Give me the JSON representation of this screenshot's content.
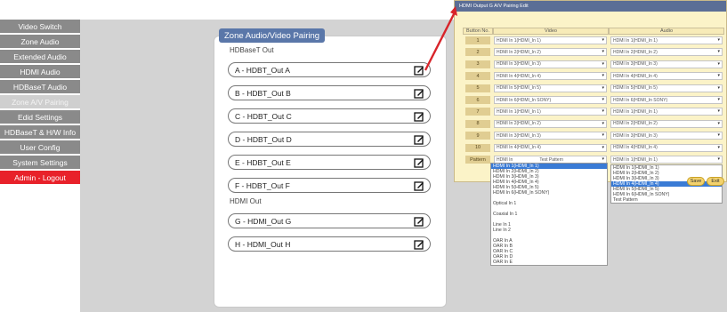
{
  "sidebar": {
    "items": [
      {
        "label": "Video Switch"
      },
      {
        "label": "Zone Audio"
      },
      {
        "label": "Extended Audio"
      },
      {
        "label": "HDMI Audio"
      },
      {
        "label": "HDBaseT Audio"
      },
      {
        "label": "Zone A/V Pairing",
        "active": true
      },
      {
        "label": "Edid Settings"
      },
      {
        "label": "HDBaseT & H/W Info"
      },
      {
        "label": "User Config"
      },
      {
        "label": "System Settings"
      },
      {
        "label": "Admin - Logout"
      }
    ]
  },
  "panel": {
    "title": "Zone Audio/Video Pairing",
    "groups": [
      {
        "label": "HDBaseT Out",
        "zones": [
          "A - HDBT_Out A",
          "B - HDBT_Out B",
          "C - HDBT_Out C",
          "D - HDBT_Out D",
          "E - HDBT_Out E",
          "F - HDBT_Out F"
        ]
      },
      {
        "label": "HDMI Out",
        "zones": [
          "G - HDMI_Out G",
          "H - HDMI_Out H"
        ]
      }
    ],
    "edit_icon": "edit-icon"
  },
  "dialog": {
    "title": "HDMI Output G A/V Pairing Edit",
    "headers": {
      "button_no": "Button No.",
      "video": "Video",
      "audio": "Audio"
    },
    "rows": [
      {
        "no": "1",
        "video": "HDMI In 1(HDMI_In 1)",
        "audio": "HDMI In 1(HDMI_In 1)"
      },
      {
        "no": "2",
        "video": "HDMI In 2(HDMI_In 2)",
        "audio": "HDMI In 2(HDMI_In 2)"
      },
      {
        "no": "3",
        "video": "HDMI In 3(HDMI_In 3)",
        "audio": "HDMI In 3(HDMI_In 3)"
      },
      {
        "no": "4",
        "video": "HDMI In 4(HDMI_In 4)",
        "audio": "HDMI In 4(HDMI_In 4)"
      },
      {
        "no": "5",
        "video": "HDMI In 5(HDMI_In 5)",
        "audio": "HDMI In 5(HDMI_In 5)"
      },
      {
        "no": "6",
        "video": "HDMI In 6(HDMI_In SONY)",
        "audio": "HDMI In 6(HDMI_In SONY)"
      },
      {
        "no": "7",
        "video": "HDMI In 1(HDMI_In 1)",
        "audio": "HDMI In 1(HDMI_In 1)"
      },
      {
        "no": "8",
        "video": "HDMI In 2(HDMI_In 2)",
        "audio": "HDMI In 2(HDMI_In 2)"
      },
      {
        "no": "9",
        "video": "HDMI In 3(HDMI_In 3)",
        "audio": "HDMI In 3(HDMI_In 3)"
      },
      {
        "no": "10",
        "video": "HDMI In 4(HDMI_In 4)",
        "audio": "HDMI In 4(HDMI_In 4)"
      }
    ],
    "pattern": {
      "label": "Pattern",
      "video": "HDMI In",
      "video_hint": "Test Pattern",
      "audio": "HDMI In 1(HDMI_In 1)"
    },
    "save_label": "Save",
    "exit_label": "Exit"
  },
  "video_dropdown": [
    {
      "label": "HDMI In 1(HDMI_In 1)",
      "highlight": true
    },
    {
      "label": "HDMI In 2(HDMI_In 2)"
    },
    {
      "label": "HDMI In 3(HDMI_In 3)"
    },
    {
      "label": "HDMI In 4(HDMI_In 4)"
    },
    {
      "label": "HDMI In 5(HDMI_In 5)"
    },
    {
      "label": "HDMI In 6(HDMI_In SONY)"
    },
    {
      "label": "",
      "dim": true
    },
    {
      "label": "Optical In 1"
    },
    {
      "label": "",
      "dim": true
    },
    {
      "label": "Coaxial In 1"
    },
    {
      "label": "",
      "dim": true
    },
    {
      "label": "Line In 1"
    },
    {
      "label": "Line In 2"
    },
    {
      "label": "",
      "dim": true
    },
    {
      "label": "OAR In A"
    },
    {
      "label": "OAR In B"
    },
    {
      "label": "OAR In C"
    },
    {
      "label": "OAR In D"
    },
    {
      "label": "OAR In E"
    }
  ],
  "audio_dropdown": [
    {
      "label": "HDMI In 1(HDMI_In 1)"
    },
    {
      "label": "HDMI In 2(HDMI_In 2)"
    },
    {
      "label": "HDMI In 3(HDMI_In 3)"
    },
    {
      "label": "HDMI In 4(HDMI_In 4)",
      "highlight": true
    },
    {
      "label": "HDMI In 5(HDMI_In 5)"
    },
    {
      "label": "HDMI In 6(HDMI_In SONY)"
    },
    {
      "label": "Test Pattern"
    }
  ],
  "colors": {
    "accent": "#e8212a",
    "title_bar": "#5b6e96",
    "panel_title": "#5a77a9",
    "highlight": "#3a7bd5"
  }
}
